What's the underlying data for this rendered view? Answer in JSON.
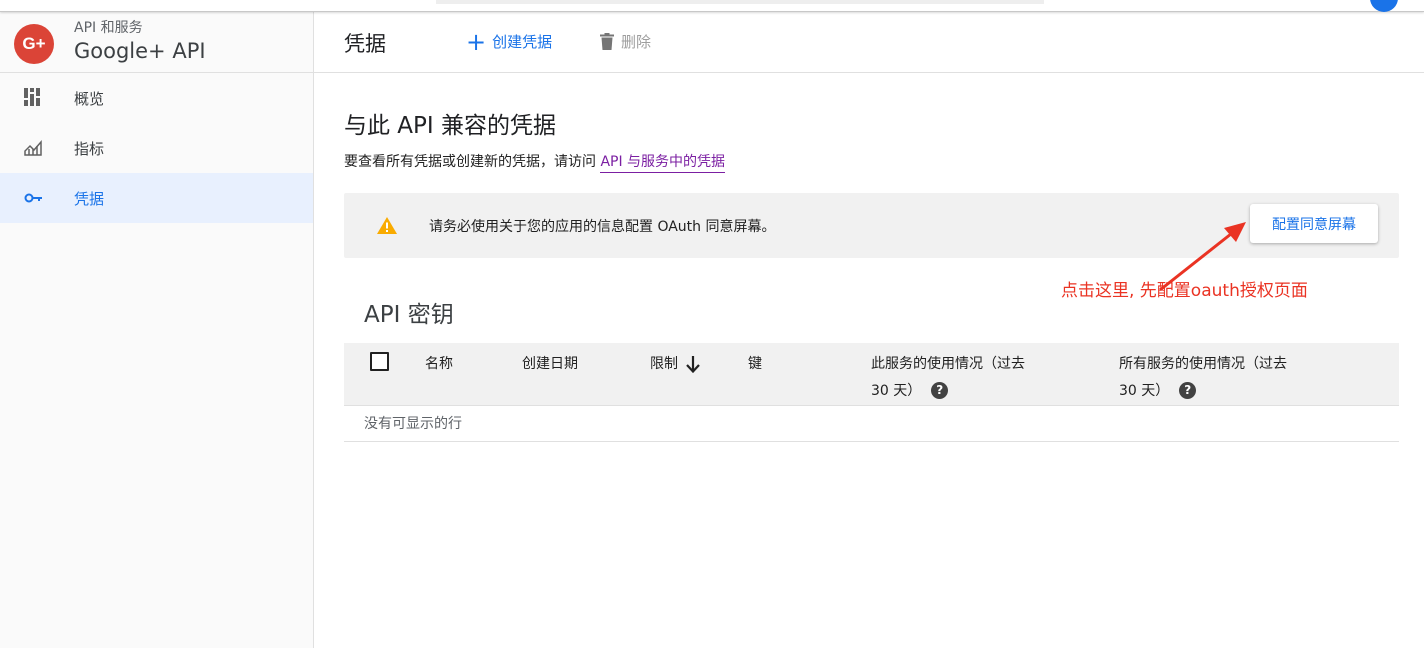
{
  "sidebar": {
    "brand_subtitle": "API 和服务",
    "brand_title": "Google+ API",
    "brand_logo": "G+",
    "items": [
      {
        "label": "概览",
        "icon": "dashboard-icon"
      },
      {
        "label": "指标",
        "icon": "metrics-icon"
      },
      {
        "label": "凭据",
        "icon": "key-icon",
        "active": true
      }
    ]
  },
  "header": {
    "title": "凭据",
    "create_label": "创建凭据",
    "delete_label": "删除"
  },
  "content": {
    "section_title": "与此 API 兼容的凭据",
    "desc_prefix": "要查看所有凭据或创建新的凭据，请访问 ",
    "desc_link": "API 与服务中的凭据",
    "warning": {
      "text": "请务必使用关于您的应用的信息配置 OAuth 同意屏幕。",
      "button": "配置同意屏幕"
    },
    "annotation": "点击这里, 先配置oauth授权页面",
    "api_keys": {
      "title": "API 密钥",
      "columns": {
        "name": "名称",
        "created": "创建日期",
        "limit": "限制",
        "key": "键",
        "usage_service_line1": "此服务的使用情况（过去",
        "usage_service_line2": "30 天）",
        "usage_all_line1": "所有服务的使用情况（过去",
        "usage_all_line2": "30 天）"
      },
      "empty_text": "没有可显示的行"
    }
  },
  "colors": {
    "accent": "#1a73e8",
    "warning": "#f9ab00",
    "annotation": "#ea3323",
    "brand": "#db4437"
  }
}
